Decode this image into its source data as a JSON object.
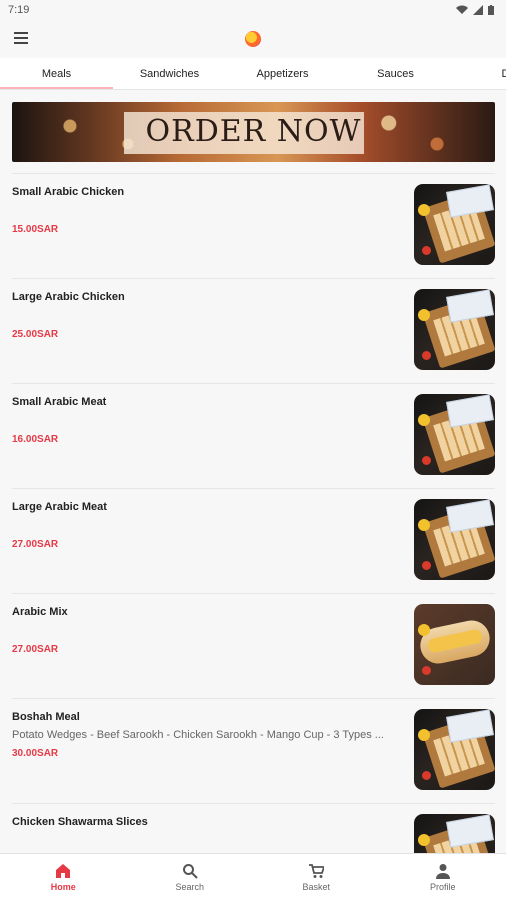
{
  "status_bar": {
    "time": "7:19"
  },
  "tabs": [
    "Meals",
    "Sandwiches",
    "Appetizers",
    "Sauces",
    "Dri"
  ],
  "banner": {
    "text": "ORDER NOW"
  },
  "items": [
    {
      "name": "Small Arabic Chicken",
      "description": "",
      "price": "15.00SAR"
    },
    {
      "name": "Large Arabic Chicken",
      "description": "",
      "price": "25.00SAR"
    },
    {
      "name": "Small Arabic Meat",
      "description": "",
      "price": "16.00SAR"
    },
    {
      "name": "Large Arabic Meat",
      "description": "",
      "price": "27.00SAR"
    },
    {
      "name": "Arabic Mix",
      "description": "",
      "price": "27.00SAR"
    },
    {
      "name": "Boshah Meal",
      "description": "Potato Wedges - Beef Sarookh - Chicken Sarookh - Mango Cup - 3 Types ...",
      "price": "30.00SAR"
    },
    {
      "name": "Chicken Shawarma Slices",
      "description": "",
      "price": ""
    }
  ],
  "bottom_nav": [
    {
      "label": "Home",
      "icon": "home-icon",
      "active": true
    },
    {
      "label": "Search",
      "icon": "search-icon",
      "active": false
    },
    {
      "label": "Basket",
      "icon": "basket-icon",
      "active": false
    },
    {
      "label": "Profile",
      "icon": "profile-icon",
      "active": false
    }
  ],
  "colors": {
    "accent": "#e63946",
    "tab_indicator": "#ffb3b8",
    "background": "#f7f7f8"
  }
}
